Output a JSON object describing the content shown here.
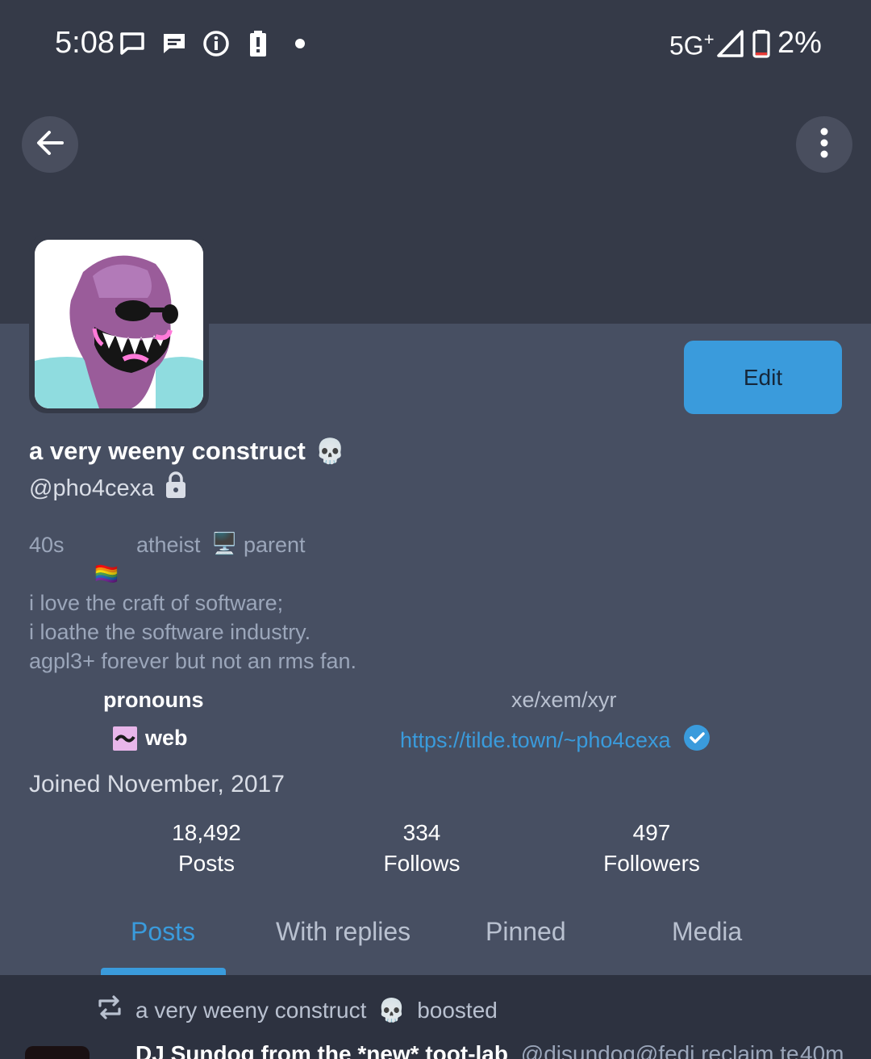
{
  "status_bar": {
    "time": "5:08",
    "network": "5G",
    "network_plus": "+",
    "battery_percent": "2%",
    "icons": [
      "message-icon",
      "chat-icon",
      "info-icon",
      "battery-alert-icon",
      "dot-icon",
      "signal-icon",
      "battery-icon"
    ]
  },
  "top_bar": {
    "back_icon": "arrow-left-icon",
    "menu_icon": "more-vertical-icon"
  },
  "profile": {
    "display_name": "a very weeny construct",
    "name_emoji": "💀",
    "handle": "@pho4cexa",
    "locked_icon": "lock-icon",
    "edit_label": "Edit",
    "bio_tag_1": "40s",
    "bio_tag_2": "atheist",
    "bio_tag_2_emoji": "🖥️",
    "bio_tag_3": "parent",
    "bio_flag_emoji": "🏳️‍🌈",
    "bio_line_1": "i love the craft of software;",
    "bio_line_2": "i loathe the software industry.",
    "bio_line_3": "agpl3+ forever but not an rms fan.",
    "fields": [
      {
        "label": "pronouns",
        "value": "xe/xem/xyr"
      },
      {
        "label": "web",
        "value": "https://tilde.town/~pho4cexa",
        "verified": true
      }
    ],
    "joined": "Joined November, 2017"
  },
  "stats": {
    "posts_count": "18,492",
    "posts_label": "Posts",
    "follows_count": "334",
    "follows_label": "Follows",
    "followers_count": "497",
    "followers_label": "Followers"
  },
  "tabs": [
    {
      "label": "Posts",
      "active": true
    },
    {
      "label": "With replies",
      "active": false
    },
    {
      "label": "Pinned",
      "active": false
    },
    {
      "label": "Media",
      "active": false
    }
  ],
  "timeline": {
    "boost_name": "a very weeny construct",
    "boost_emoji": "💀",
    "boost_suffix": "boosted",
    "post_author": "DJ Sundog from the *new* toot-lab",
    "post_handle": "@djsundog@fedi.reclaim.te",
    "post_time": "40m"
  },
  "colors": {
    "accent": "#3a9bdc",
    "header_bg": "#353a48",
    "profile_bg": "#474f62",
    "timeline_bg": "#2d3240"
  }
}
